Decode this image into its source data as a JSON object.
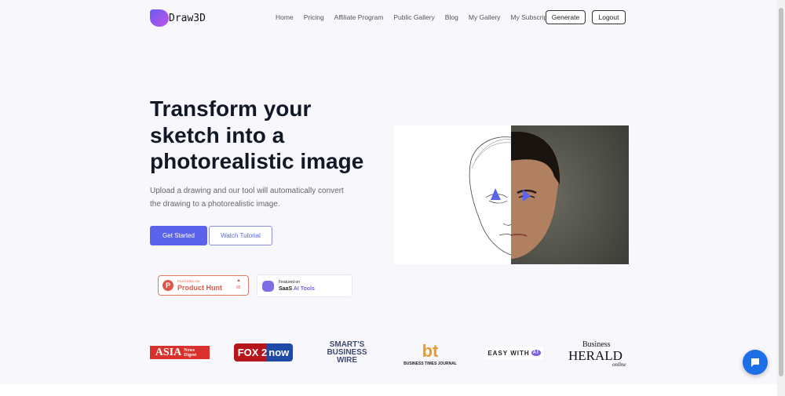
{
  "brand": {
    "name": "Draw3D"
  },
  "nav": {
    "links": [
      "Home",
      "Pricing",
      "Affiliate Program",
      "Public Gallery",
      "Blog",
      "My Gallery",
      "My Subscriptions"
    ],
    "generate": "Generate",
    "logout": "Logout"
  },
  "hero": {
    "title": "Transform your sketch into a photorealistic image",
    "subtitle": "Upload a drawing and our tool will automatically convert the drawing to a photorealistic image.",
    "get_started": "Get Started",
    "watch_tutorial": "Watch Tutorial"
  },
  "badges": {
    "ph_featured": "FEATURED ON",
    "ph_name": "Product Hunt",
    "ph_count": "95",
    "saas_featured": "Featured on",
    "saas_name1": "SaaS",
    "saas_name2": "AI Tools"
  },
  "press": [
    "ASIA",
    "News Digest",
    "FOX 2",
    "now",
    "SMART'S BUSINESS WIRE",
    "BUSINESS TIMES JOURNAL",
    "EASY WITH",
    "AI",
    "Business",
    "HERALD",
    "online"
  ],
  "colors": {
    "accent": "#5b63eb",
    "chat": "#1d6fe8"
  }
}
